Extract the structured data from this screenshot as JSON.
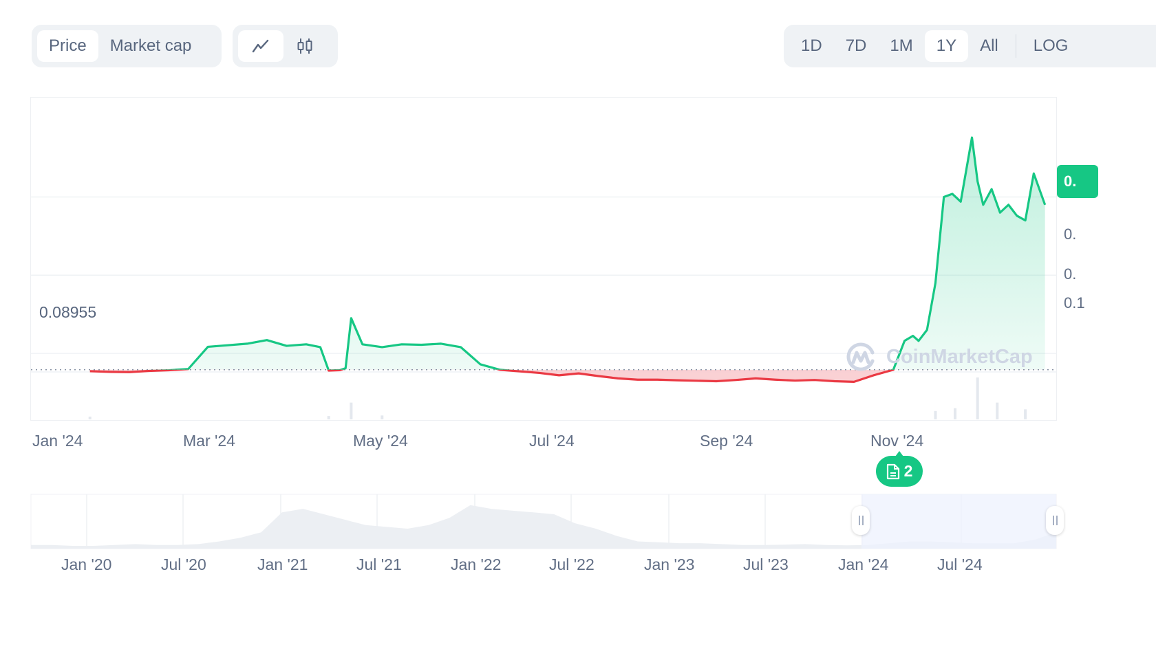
{
  "toolbar": {
    "data_type_tabs": [
      {
        "label": "Price",
        "active": true
      },
      {
        "label": "Market cap",
        "active": false
      }
    ],
    "chart_type_tabs": [
      {
        "icon": "line-chart-icon",
        "active": true
      },
      {
        "icon": "candlestick-chart-icon",
        "active": false
      }
    ],
    "range_tabs": [
      {
        "label": "1D",
        "active": false
      },
      {
        "label": "7D",
        "active": false
      },
      {
        "label": "1M",
        "active": false
      },
      {
        "label": "1Y",
        "active": true
      },
      {
        "label": "All",
        "active": false
      }
    ],
    "log_label": "LOG"
  },
  "colors": {
    "up": "#16c784",
    "down": "#ea3943",
    "up_fill": "#d7f5e8",
    "down_fill": "#f9c9cc",
    "grid": "#eff2f5",
    "volume": "#e4e8ee",
    "navigator_area": "#eceff3",
    "navigator_selection": "#eef1fd"
  },
  "watermark": "CoinMarketCap",
  "event_badge": {
    "icon": "document-icon",
    "count": "2"
  },
  "current_price_badge": "0.",
  "chart_data": {
    "type": "area",
    "title": "",
    "baseline": 0.08955,
    "baseline_label": "0.08955",
    "x_tick_labels": [
      "Jan '24",
      "Mar '24",
      "May '24",
      "Jul '24",
      "Sep '24",
      "Nov '24"
    ],
    "y_tick_labels_visible": [
      "0.",
      "0.",
      "0.1"
    ],
    "ylim": [
      0.06,
      0.26
    ],
    "y_gridlines": [
      0.1,
      0.15,
      0.2
    ],
    "series": [
      {
        "name": "Price",
        "x": [
          "2024-01-22",
          "2024-01-29",
          "2024-02-05",
          "2024-02-12",
          "2024-02-19",
          "2024-02-26",
          "2024-03-04",
          "2024-03-11",
          "2024-03-18",
          "2024-03-25",
          "2024-04-01",
          "2024-04-08",
          "2024-04-13",
          "2024-04-16",
          "2024-04-20",
          "2024-04-22",
          "2024-04-24",
          "2024-04-28",
          "2024-05-05",
          "2024-05-12",
          "2024-05-19",
          "2024-05-26",
          "2024-06-02",
          "2024-06-09",
          "2024-06-16",
          "2024-06-23",
          "2024-06-30",
          "2024-07-07",
          "2024-07-14",
          "2024-07-21",
          "2024-07-28",
          "2024-08-04",
          "2024-08-11",
          "2024-08-18",
          "2024-08-25",
          "2024-09-01",
          "2024-09-08",
          "2024-09-15",
          "2024-09-22",
          "2024-09-29",
          "2024-10-06",
          "2024-10-13",
          "2024-10-20",
          "2024-10-27",
          "2024-11-03",
          "2024-11-07",
          "2024-11-10",
          "2024-11-12",
          "2024-11-15",
          "2024-11-18",
          "2024-11-21",
          "2024-11-24",
          "2024-11-27",
          "2024-12-01",
          "2024-12-03",
          "2024-12-05",
          "2024-12-08",
          "2024-12-11",
          "2024-12-14",
          "2024-12-17",
          "2024-12-20",
          "2024-12-23",
          "2024-12-27"
        ],
        "values": [
          0.0886,
          0.0882,
          0.088,
          0.0888,
          0.0892,
          0.09,
          0.1042,
          0.1052,
          0.1062,
          0.1085,
          0.1048,
          0.1058,
          0.104,
          0.089,
          0.0893,
          0.0905,
          0.1225,
          0.1058,
          0.104,
          0.1058,
          0.1055,
          0.1062,
          0.104,
          0.093,
          0.0895,
          0.0885,
          0.0875,
          0.086,
          0.0872,
          0.0855,
          0.084,
          0.0832,
          0.0832,
          0.0828,
          0.0825,
          0.0822,
          0.083,
          0.084,
          0.0832,
          0.0826,
          0.083,
          0.0822,
          0.0818,
          0.086,
          0.0895,
          0.108,
          0.1112,
          0.108,
          0.115,
          0.145,
          0.2,
          0.202,
          0.197,
          0.238,
          0.21,
          0.195,
          0.205,
          0.19,
          0.195,
          0.188,
          0.185,
          0.215,
          0.195
        ]
      }
    ],
    "volume": {
      "x": [
        "2024-01-22",
        "2024-04-16",
        "2024-04-24",
        "2024-05-05",
        "2024-11-18",
        "2024-11-25",
        "2024-12-03",
        "2024-12-10",
        "2024-12-20"
      ],
      "values": [
        0.5,
        0.6,
        3.0,
        0.7,
        1.5,
        2.0,
        7.5,
        3.0,
        1.8
      ]
    },
    "navigator": {
      "x_tick_labels": [
        "Jan '20",
        "Jul '20",
        "Jan '21",
        "Jul '21",
        "Jan '22",
        "Jul '22",
        "Jan '23",
        "Jul '23",
        "Jan '24",
        "Jul '24"
      ],
      "selection_range": [
        "2024-01-01",
        "2024-12-27"
      ],
      "series_values": [
        0.02,
        0.02,
        0.015,
        0.015,
        0.02,
        0.025,
        0.02,
        0.02,
        0.025,
        0.04,
        0.06,
        0.09,
        0.2,
        0.22,
        0.19,
        0.16,
        0.13,
        0.12,
        0.11,
        0.13,
        0.17,
        0.24,
        0.22,
        0.21,
        0.2,
        0.19,
        0.14,
        0.11,
        0.07,
        0.04,
        0.035,
        0.03,
        0.03,
        0.025,
        0.02,
        0.02,
        0.022,
        0.025,
        0.02,
        0.018,
        0.02,
        0.03,
        0.04,
        0.04,
        0.035,
        0.03,
        0.03,
        0.03,
        0.05,
        0.09
      ]
    }
  }
}
